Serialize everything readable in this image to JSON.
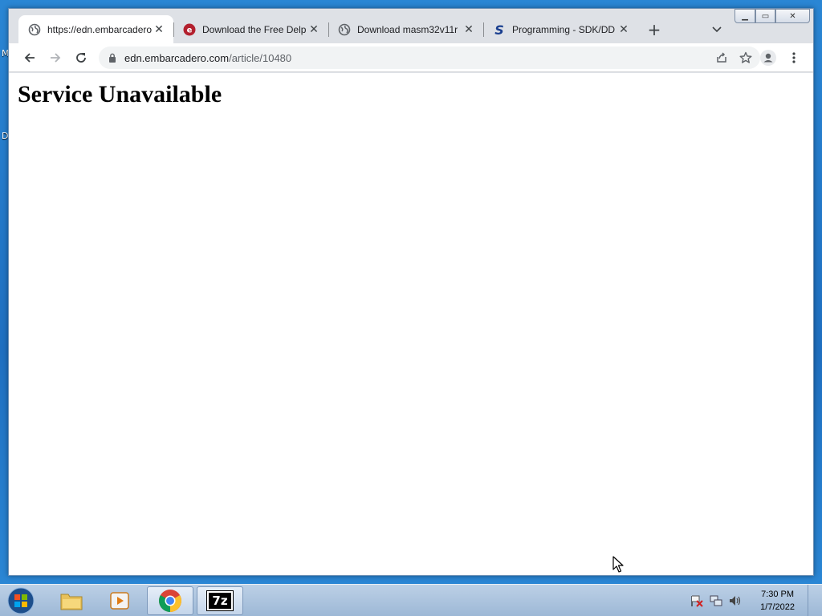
{
  "desktop": {
    "labels": [
      "M",
      "D"
    ]
  },
  "browser": {
    "tabs": [
      {
        "title": "https://edn.embarcadero.",
        "icon": "globe-icon",
        "active": true
      },
      {
        "title": "Download the Free Delp",
        "icon": "embarcadero-icon",
        "active": false
      },
      {
        "title": "Download masm32v11r",
        "icon": "globe-icon",
        "active": false
      },
      {
        "title": "Programming - SDK/DD",
        "icon": "s-logo-icon",
        "active": false
      }
    ],
    "close_glyph": "✕",
    "new_tab_glyph": "+",
    "window_buttons": {
      "minimize": "▁",
      "maximize": "▭",
      "close": "✕"
    },
    "address": {
      "host": "edn.embarcadero.com",
      "path": "/article/10480"
    },
    "page": {
      "heading": "Service Unavailable"
    }
  },
  "taskbar": {
    "apps": [
      "file-explorer-icon",
      "media-player-icon",
      "chrome-icon",
      "7zip-icon"
    ],
    "sevenzip_label": "7z",
    "clock": {
      "time": "7:30 PM",
      "date": "1/7/2022"
    }
  },
  "colors": {
    "desktop": "#1f79c8",
    "tab_strip": "#dee1e6",
    "omnibox": "#f1f3f4",
    "embarcadero_red": "#b3202e",
    "sdk_blue": "#1a3f8f"
  }
}
